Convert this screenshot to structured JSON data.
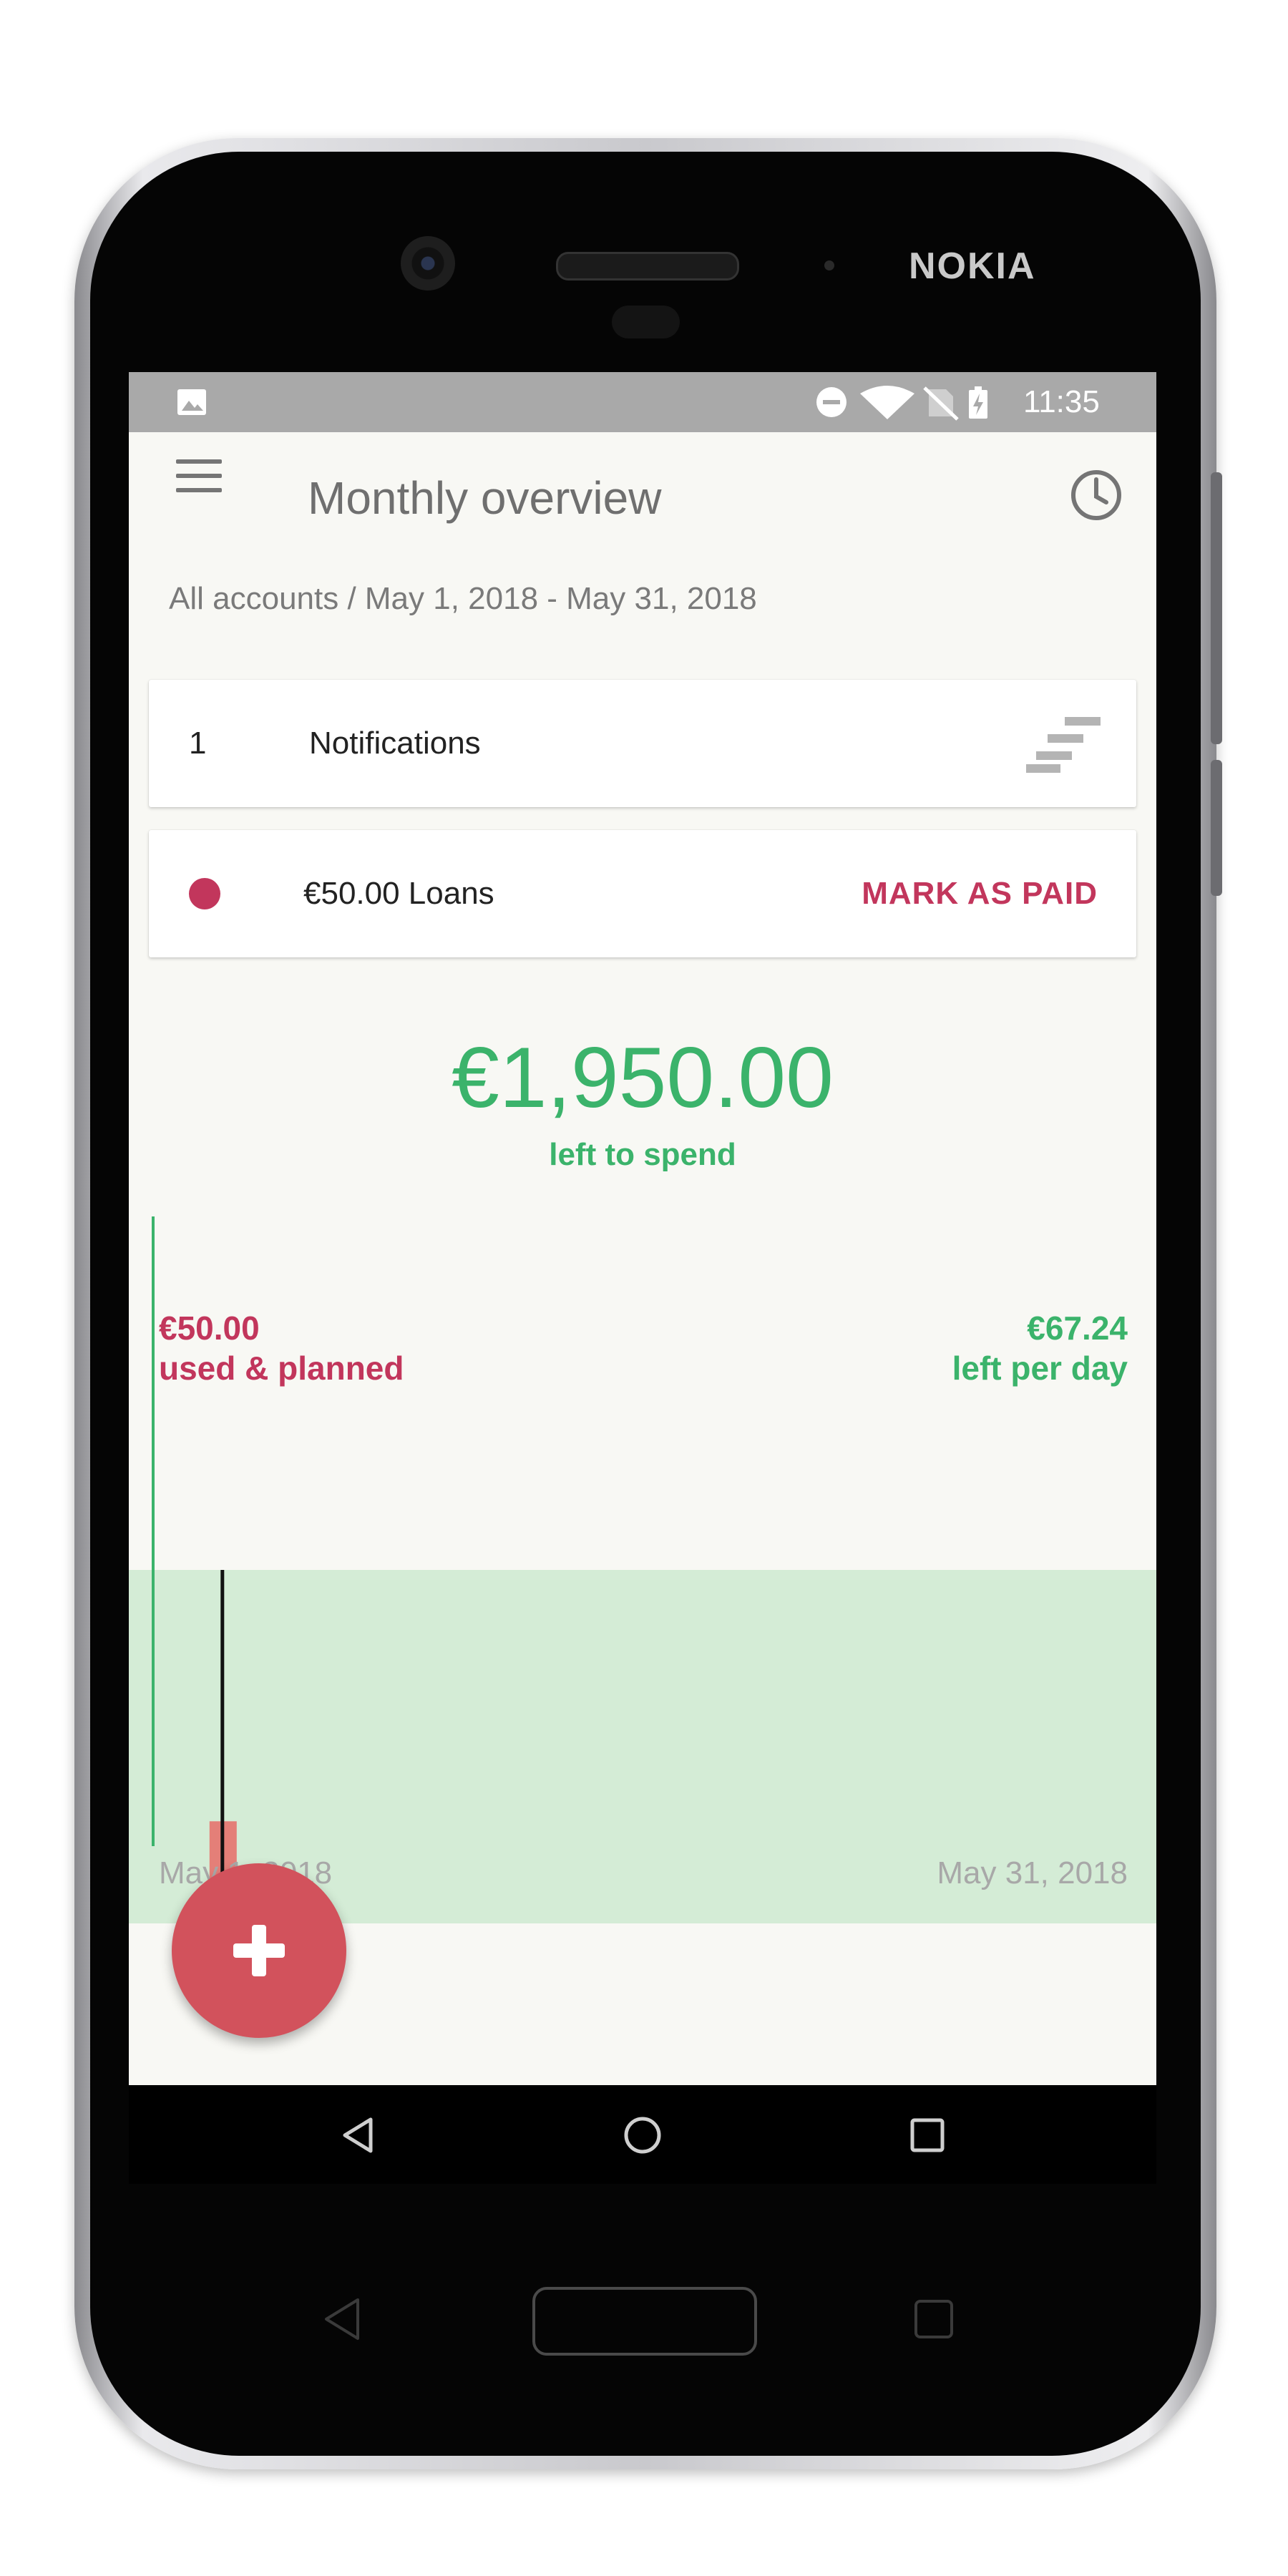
{
  "device": {
    "brand": "NOKIA"
  },
  "status_bar": {
    "time": "11:35"
  },
  "app_bar": {
    "title": "Monthly overview"
  },
  "subtitle": "All accounts / May 1, 2018 - May 31, 2018",
  "notifications": {
    "count": "1",
    "label": "Notifications"
  },
  "loan": {
    "label": "€50.00 Loans",
    "action": "MARK AS PAID",
    "color": "#c2365c"
  },
  "summary": {
    "amount": "€1,950.00",
    "caption": "left to spend",
    "color": "#3bb36b"
  },
  "used": {
    "amount": "€50.00",
    "label": "used & planned"
  },
  "per_day": {
    "amount": "€67.24",
    "label": "left per day"
  },
  "chart_data": {
    "type": "area",
    "x_start_label": "May 1, 2018",
    "x_end_label": "May 31, 2018",
    "budget_area_color": "#d4ecd6",
    "spent_bar_color": "#e47f78",
    "today_marker": "May 3, 2018",
    "spent_values": [
      {
        "x": "May 3, 2018",
        "y": 50.0
      }
    ]
  },
  "icons": {
    "status": [
      "image-icon",
      "do-not-disturb-icon",
      "wifi-icon",
      "no-sim-icon",
      "battery-charging-icon"
    ],
    "menu": "menu-icon",
    "history": "history-icon",
    "notifications": "stack-icon",
    "fab": "plus-icon"
  }
}
